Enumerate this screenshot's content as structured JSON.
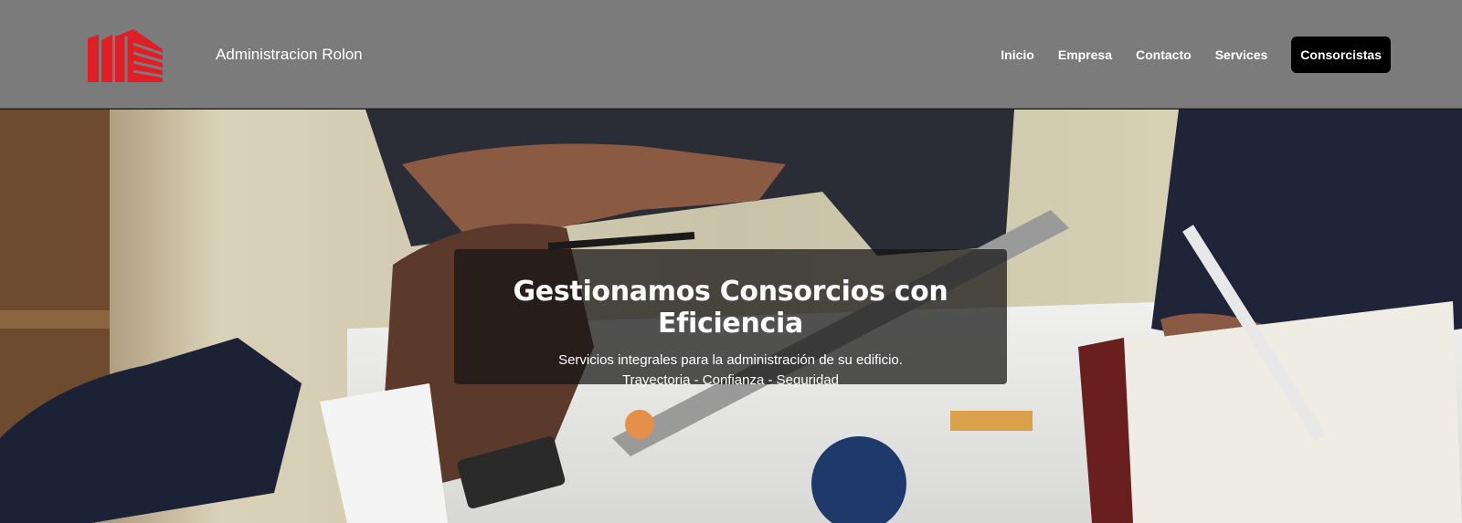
{
  "header": {
    "brand_name": "Administracion Rolon",
    "logo_icon": "building-logo-icon",
    "colors": {
      "nav_bg": "#7b7b7b",
      "logo_red": "#e11e26",
      "cta_bg": "#000000"
    }
  },
  "nav": {
    "items": [
      {
        "label": "Inicio"
      },
      {
        "label": "Empresa"
      },
      {
        "label": "Contacto"
      },
      {
        "label": "Services"
      }
    ],
    "cta_label": "Consorcistas"
  },
  "hero": {
    "title": "Gestionamos Consorcios con Eficiencia",
    "subtitle_line1": "Servicios integrales para la administración de su edificio.",
    "subtitle_line2": "Trayectoria - Confianza - Seguridad",
    "background_image": "business-meeting-photo"
  }
}
